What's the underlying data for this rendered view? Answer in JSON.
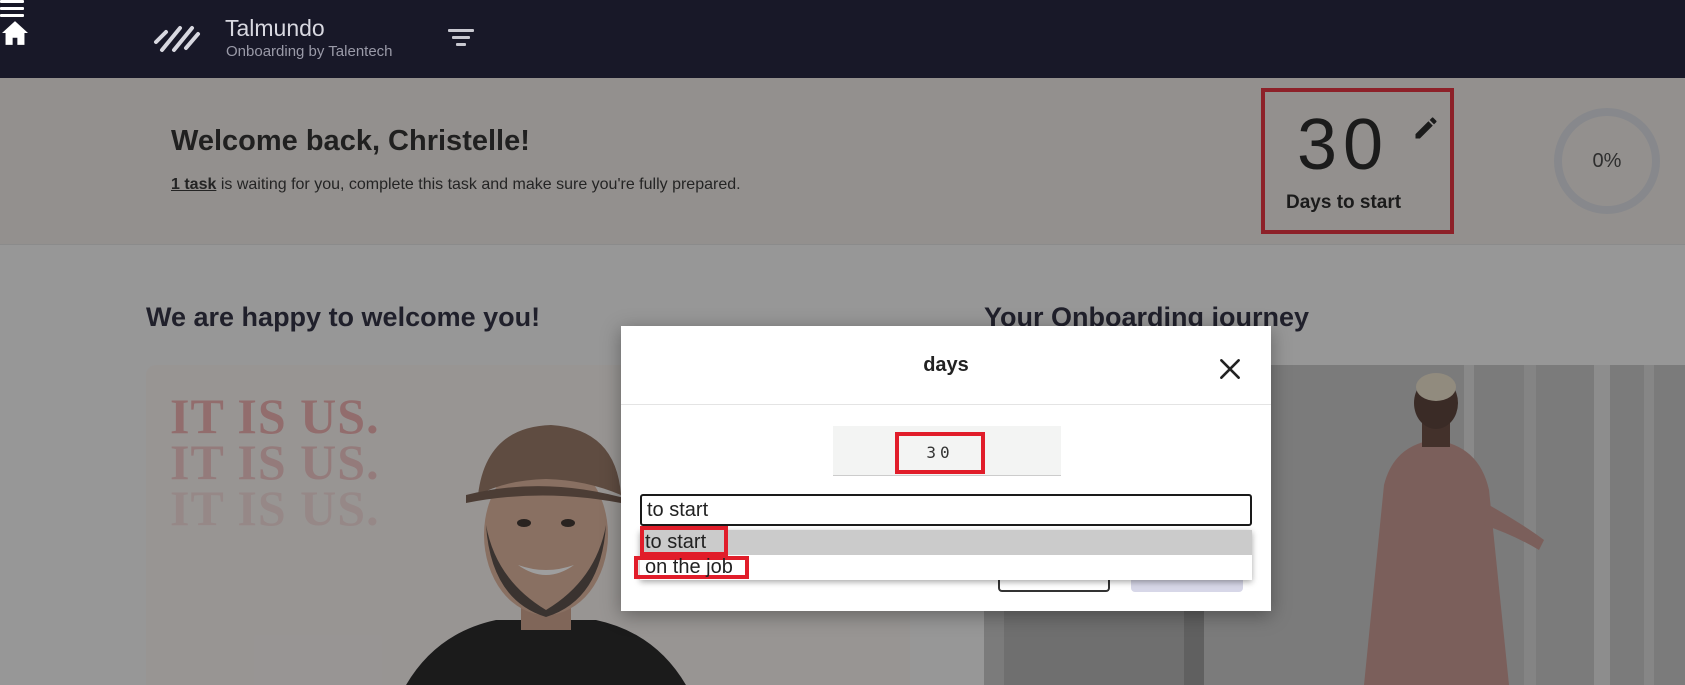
{
  "header": {
    "brand_name": "Talmundo",
    "brand_sub": "Onboarding by Talentech"
  },
  "hero": {
    "welcome_title": "Welcome back, Christelle!",
    "task_link": "1 task",
    "task_rest": " is waiting for you, complete this task and make sure you're fully prepared.",
    "days_number": "30",
    "days_label": "Days to start",
    "progress_label": "0%"
  },
  "main": {
    "left_title": "We are happy to welcome you!",
    "right_title": "Your Onboarding journey",
    "poster_text": [
      "IT IS US.",
      "IT IS US.",
      "IT IS US."
    ]
  },
  "dialog": {
    "title": "days",
    "number_value": "30",
    "select_value": "to start",
    "options": [
      "to start",
      "on the job"
    ],
    "selected_option": "to start"
  },
  "colors": {
    "topbar": "#181828",
    "highlight": "#e11d2a",
    "option_selected_bg": "#cbcbcb"
  }
}
